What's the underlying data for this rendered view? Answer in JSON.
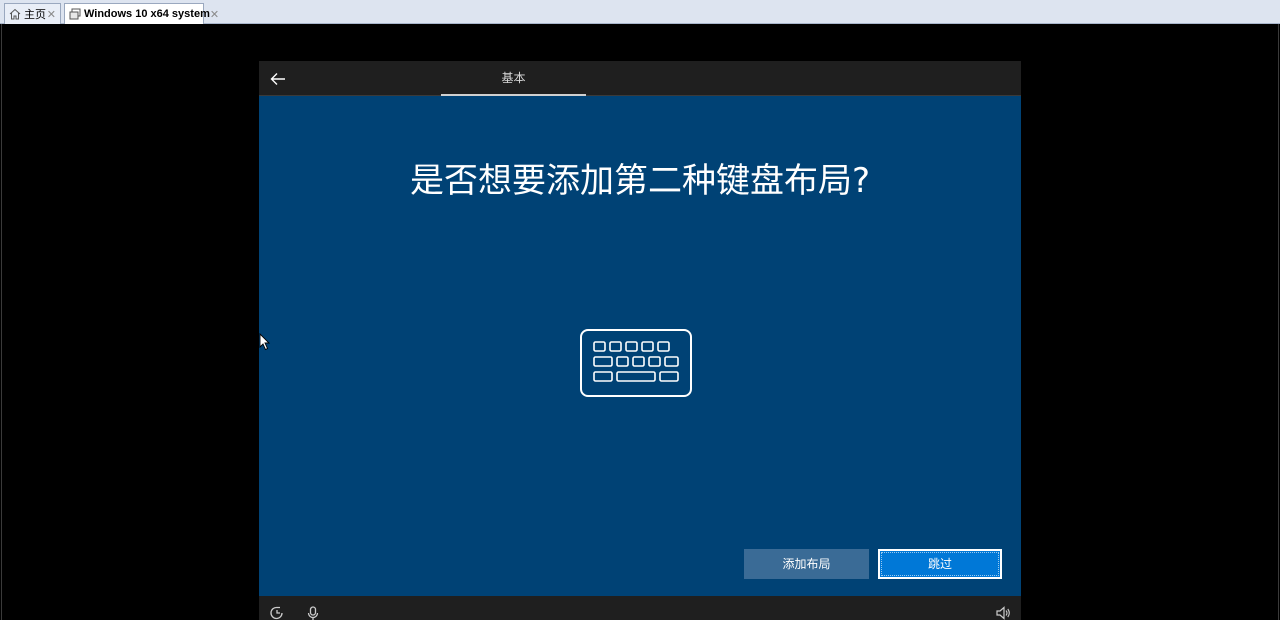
{
  "host": {
    "tabs": [
      {
        "label": "主页",
        "icon": "home-icon"
      },
      {
        "label": "Windows 10 x64 system",
        "icon": "vm-icon"
      }
    ],
    "close_glyph": "✕"
  },
  "oobe": {
    "header_tab": "基本",
    "title": "是否想要添加第二种键盘布局?",
    "buttons": {
      "add_layout": "添加布局",
      "skip": "跳过"
    },
    "footer_icons": [
      "ease-of-access-icon",
      "microphone-icon",
      "volume-icon"
    ]
  },
  "colors": {
    "oobe_background": "#004275",
    "primary_button": "#0078d7",
    "secondary_button": "#3a6b96"
  }
}
